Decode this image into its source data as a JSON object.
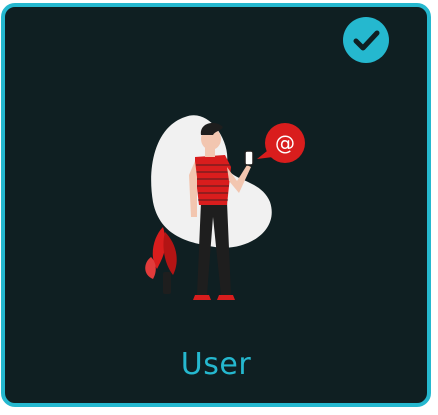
{
  "card": {
    "label": "User",
    "selected": true,
    "accent_color": "#25b8cf",
    "background_color": "#0f1f22"
  },
  "illustration": {
    "bubble_symbol": "@",
    "icons": [
      "check-icon",
      "user-illustration",
      "email-speech-bubble-icon",
      "plant-icon",
      "phone-icon"
    ],
    "colors": {
      "blob": "#f1f1f1",
      "shirt": "#d91d1d",
      "pants": "#1e1e1e",
      "plant": "#d91d1d",
      "skin": "#f2c6b0"
    }
  }
}
